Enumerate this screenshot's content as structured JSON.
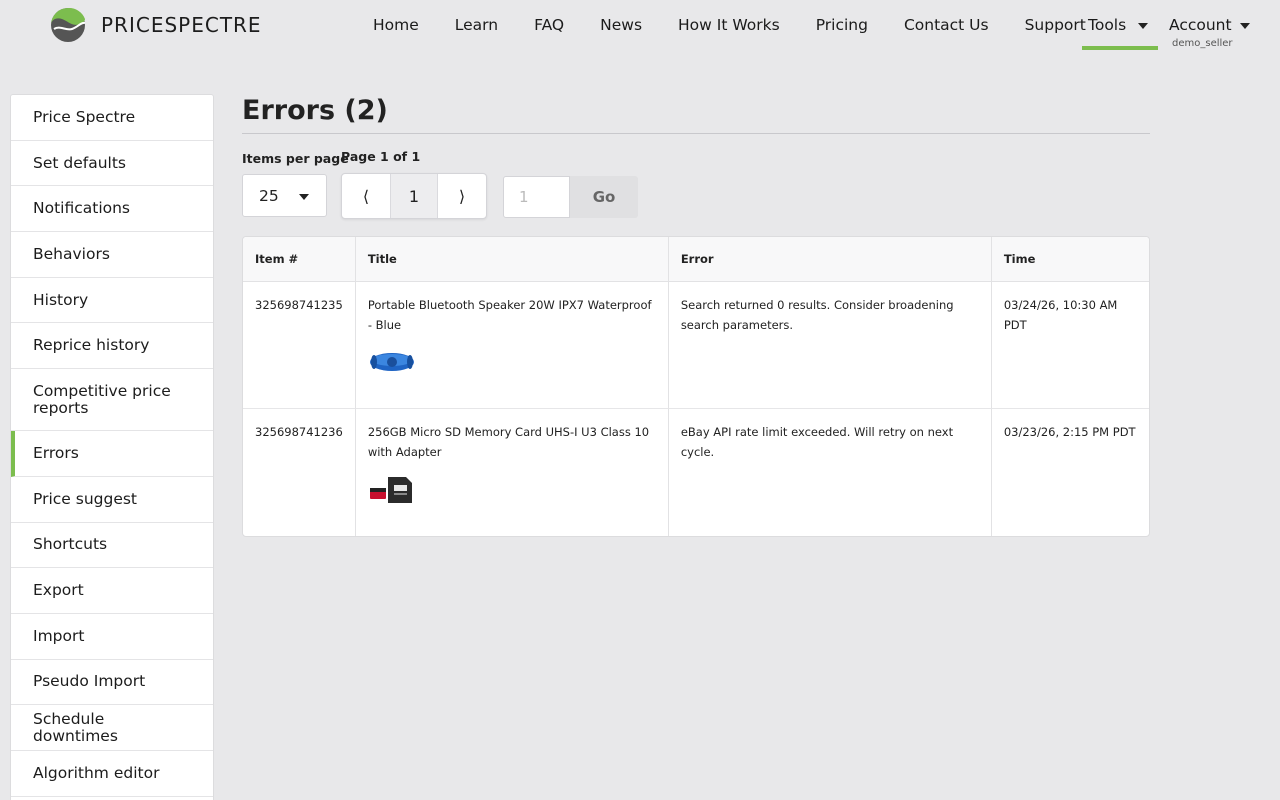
{
  "brand": {
    "name": "PRICESPECTRE",
    "accent": "#7cbd4e"
  },
  "nav": {
    "links": [
      "Home",
      "Learn",
      "FAQ",
      "News",
      "How It Works",
      "Pricing",
      "Contact Us",
      "Support"
    ],
    "tools_label": "Tools",
    "account_label": "Account",
    "account_user": "demo_seller"
  },
  "sidebar": {
    "items": [
      "Price Spectre",
      "Set defaults",
      "Notifications",
      "Behaviors",
      "History",
      "Reprice history",
      "Competitive price reports",
      "Errors",
      "Price suggest",
      "Shortcuts",
      "Export",
      "Import",
      "Pseudo Import",
      "Schedule downtimes",
      "Algorithm editor"
    ],
    "active": "Errors"
  },
  "main": {
    "title": "Errors (2)",
    "items_per_page_label": "Items per page",
    "items_per_page_value": "25",
    "page_status": "Page 1 of 1",
    "prev_glyph": "⟨",
    "current_page": "1",
    "next_glyph": "⟩",
    "goto_placeholder": "1",
    "go_label": "Go"
  },
  "table": {
    "columns": [
      "Item #",
      "Title",
      "Error",
      "Time"
    ],
    "rows": [
      {
        "item": "325698741235",
        "title": "Portable Bluetooth Speaker 20W IPX7 Waterproof - Blue",
        "thumb_icon": "speaker-thumbnail",
        "error": "Search returned 0 results. Consider broadening search parameters.",
        "time": "03/24/26, 10:30 AM PDT"
      },
      {
        "item": "325698741236",
        "title": "256GB Micro SD Memory Card UHS-I U3 Class 10 with Adapter",
        "thumb_icon": "sdcard-thumbnail",
        "error": "eBay API rate limit exceeded. Will retry on next cycle.",
        "time": "03/23/26, 2:15 PM PDT"
      }
    ]
  }
}
